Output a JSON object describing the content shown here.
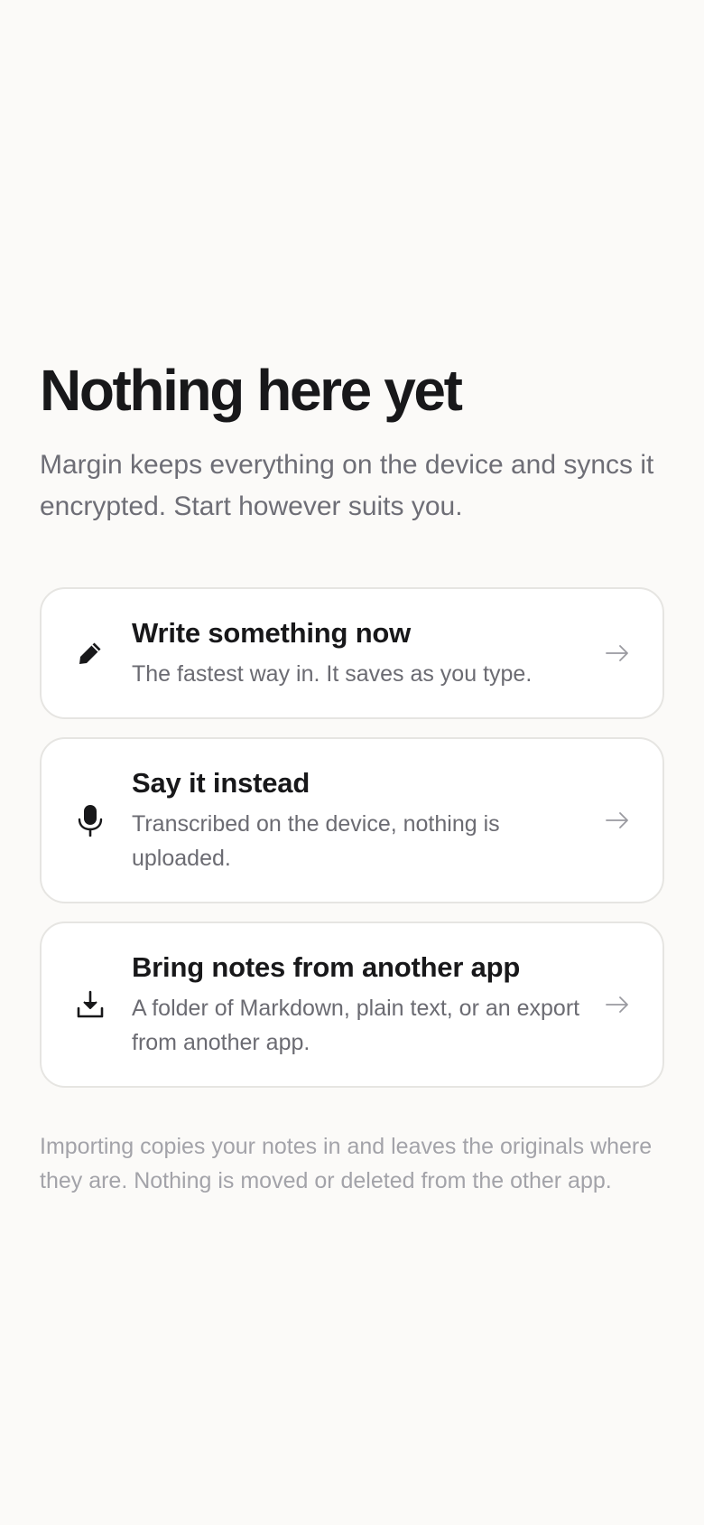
{
  "empty_state": {
    "title": "Nothing here yet",
    "subtitle": "Margin keeps everything on the device and syncs it encrypted. Start however suits you."
  },
  "options": [
    {
      "icon": "pencil-icon",
      "title": "Write something now",
      "description": "The fastest way in. It saves as you type."
    },
    {
      "icon": "microphone-icon",
      "title": "Say it instead",
      "description": "Transcribed on the device, nothing is uploaded."
    },
    {
      "icon": "download-icon",
      "title": "Bring notes from another app",
      "description": "A folder of Markdown, plain text, or an export from another app."
    }
  ],
  "footnote": "Importing copies your notes in and leaves the originals where they are. Nothing is moved or deleted from the other app.",
  "colors": {
    "background": "#fbfaf8",
    "text_primary": "#18181a",
    "text_secondary": "#6b6b72",
    "text_muted": "#a3a3a9",
    "card_border": "#e6e5e2"
  }
}
